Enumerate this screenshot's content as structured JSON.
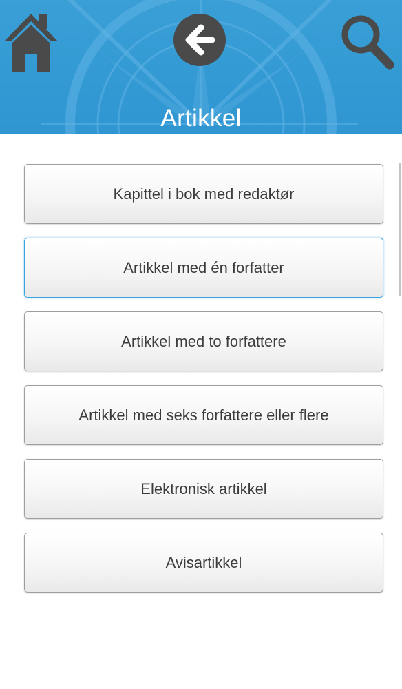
{
  "header": {
    "title": "Artikkel",
    "home_icon": "home-icon",
    "back_icon": "arrow-left-icon",
    "search_icon": "search-icon",
    "background_color": "#3399d4"
  },
  "items": [
    {
      "label": "Kapittel i bok med redaktør"
    },
    {
      "label": "Artikkel med én forfatter"
    },
    {
      "label": "Artikkel med to forfattere"
    },
    {
      "label": "Artikkel med seks forfattere eller flere"
    },
    {
      "label": "Elektronisk artikkel"
    },
    {
      "label": "Avisartikkel"
    }
  ]
}
